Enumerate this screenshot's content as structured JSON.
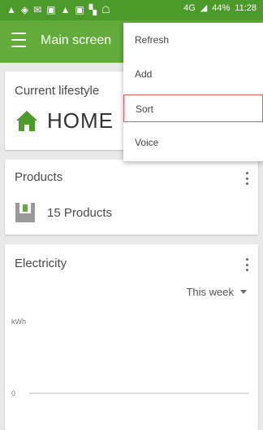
{
  "status_bar": {
    "network": "4G",
    "battery": "44%",
    "time": "11:28"
  },
  "app_bar": {
    "title": "Main screen"
  },
  "lifestyle_card": {
    "title": "Current lifestyle",
    "value": "HOME",
    "icon": "home-icon",
    "icon_color": "#4c9a2a"
  },
  "products_card": {
    "title": "Products",
    "value": "15 Products",
    "icon": "product-box-icon",
    "icon_color": "#9a9a9a"
  },
  "electricity_card": {
    "title": "Electricity",
    "period": "This week",
    "unit": "kWh"
  },
  "chart_data": {
    "type": "line",
    "title": "",
    "xlabel": "",
    "ylabel": "kWh",
    "y_ticks": [
      "0"
    ],
    "series": []
  },
  "overflow_menu": {
    "items": [
      {
        "label": "Refresh"
      },
      {
        "label": "Add"
      },
      {
        "label": "Sort",
        "selected": true
      },
      {
        "label": "Voice"
      }
    ]
  },
  "colors": {
    "primary": "#63ab3a",
    "status_bar": "#4c9a2a",
    "selection_outline": "#e35a5a"
  }
}
